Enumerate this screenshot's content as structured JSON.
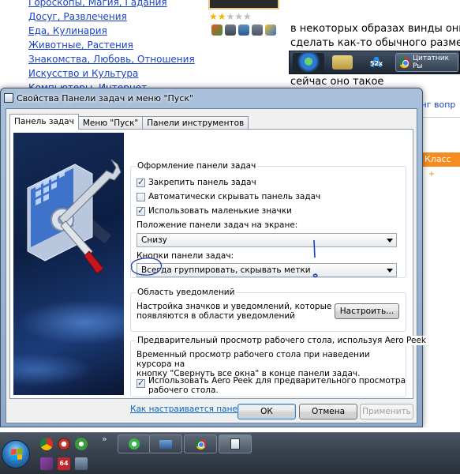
{
  "background_page": {
    "links": [
      "Гороскопы, Магия, Гадания",
      "Досуг, Развлечения",
      "Еда, Кулинария",
      "Животные, Растения",
      "Знакомства, Любовь, Отношения",
      "Искусство и Культура",
      "Компьютеры, Интернет"
    ],
    "question_line1": "в некоторых образах винды они из",
    "question_line2": "сделать как-то обычного размера?",
    "embedded_tab_label": "Цитатник Ры",
    "embedded_badge": "52x",
    "now_text": "сейчас оно такое",
    "rating_link": "тинг вопр",
    "klass_button": "Класс",
    "klass_plus": "+",
    "colors": {
      "link": "#1a44c8",
      "klass": "#f68b1f"
    }
  },
  "dialog": {
    "title": "Свойства Панели задач и меню \"Пуск\"",
    "tabs": [
      {
        "label": "Панель задач",
        "active": true
      },
      {
        "label": "Меню \"Пуск\"",
        "active": false
      },
      {
        "label": "Панели инструментов",
        "active": false
      }
    ],
    "appearance": {
      "title": "Оформление панели задач",
      "lock_label": "Закрепить панель задач",
      "lock_checked": true,
      "autohide_label": "Автоматически скрывать панель задач",
      "autohide_checked": false,
      "small_icons_label": "Использовать маленькие значки",
      "small_icons_checked": true,
      "location_label": "Положение панели задач на экране:",
      "location_value": "Снизу",
      "buttons_label": "Кнопки панели задач:",
      "buttons_value": "Всегда группировать, скрывать метки"
    },
    "notifications": {
      "title": "Область уведомлений",
      "description_line1": "Настройка значков и уведомлений, которые",
      "description_line2": "появляются в области уведомлений",
      "customize_button": "Настроить..."
    },
    "aero_peek": {
      "title": "Предварительный просмотр рабочего стола, используя Aero Peek",
      "description_line1": "Временный просмотр рабочего стола при наведении курсора на",
      "description_line2": "кнопку \"Свернуть все окна\" в конце панели задач.",
      "checkbox_line1": "Использовать Aero Peek для предварительного просмотра",
      "checkbox_line2": "рабочего стола.",
      "checked": true
    },
    "help_link": "Как настраивается панель задач?",
    "ok_button": "ОК",
    "cancel_button": "Отмена",
    "apply_button": "Применить",
    "apply_enabled": false
  },
  "taskbar": {
    "quick_launch": [
      "chrome-icon",
      "opera-icon",
      "utorrent-icon",
      "visual-studio-icon",
      "app-64-icon",
      "media-icon"
    ],
    "overflow_chevron": "»",
    "buttons": [
      "icq-icon",
      "folder-icon",
      "chrome-icon",
      "properties-icon"
    ],
    "ql_64_label": "64"
  }
}
